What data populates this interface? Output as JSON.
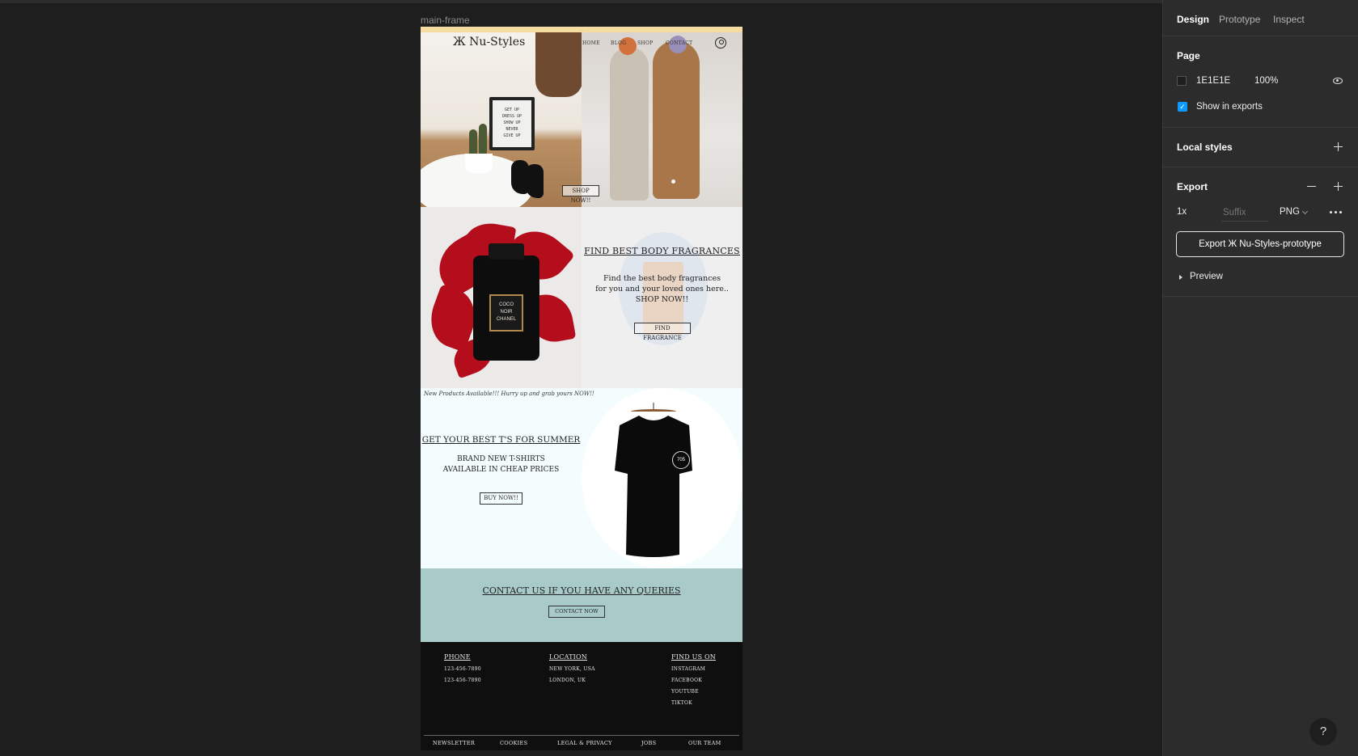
{
  "canvas": {
    "frame_label": "main-frame"
  },
  "site": {
    "promo_text": "…",
    "logo": "Ж Nu-Styles",
    "nav": [
      "HOME",
      "BLOG",
      "SHOP",
      "CONTACT"
    ],
    "hero_button": "SHOP NOW!!",
    "hero_board_text": "GET UP\nDRESS UP\nSHOW UP\nNEVER\nGIVE UP",
    "fragrance": {
      "bottle_label": "COCO\nNOIR\nCHANEL",
      "title": "FIND BEST BODY FRAGRANCES",
      "description": "Find the best body fragrances\nfor you and your loved ones here..\nSHOP NOW!!",
      "button": "FIND FRAGRANCE"
    },
    "tees": {
      "tagline": "New Products Available!!! Hurry up and grab yours NOW!!",
      "title": "GET YOUR BEST T'S FOR SUMMER",
      "description": "BRAND NEW T-SHIRTS\nAVAILABLE IN CHEAP PRICES",
      "button": "BUY NOW!!",
      "logo": "705"
    },
    "contact": {
      "title": "CONTACT US IF YOU HAVE ANY QUERIES",
      "button": "CONTACT NOW"
    },
    "footer": {
      "columns": [
        {
          "title": "PHONE",
          "items": [
            "123-456-7890",
            "123-456-7890"
          ]
        },
        {
          "title": "LOCATION",
          "items": [
            "NEW YORK, USA",
            "LONDON, UK"
          ]
        },
        {
          "title": "FIND US ON",
          "items": [
            "INSTAGRAM",
            "FACEBOOK",
            "YOUTUBE",
            "TIKTOK"
          ]
        }
      ],
      "bottom_links": [
        "NEWSLETTER",
        "COOKIES",
        "LEGAL & PRIVACY",
        "JOBS",
        "OUR TEAM"
      ]
    }
  },
  "panel": {
    "tabs": [
      "Design",
      "Prototype",
      "Inspect"
    ],
    "page": {
      "title": "Page",
      "color": "1E1E1E",
      "opacity": "100%",
      "show_in_exports": "Show in exports"
    },
    "local_styles": "Local styles",
    "export": {
      "title": "Export",
      "scale": "1x",
      "suffix_placeholder": "Suffix",
      "format": "PNG",
      "button": "Export Ж Nu-Styles-prototype",
      "preview": "Preview"
    },
    "help": "?"
  },
  "colors": {
    "canvas_bg": "#1e1e1e",
    "panel_bg": "#2c2c2c",
    "accent_blue": "#0d99ff",
    "contact_bg": "#a8cbca",
    "footer_bg": "#0f0f10"
  }
}
